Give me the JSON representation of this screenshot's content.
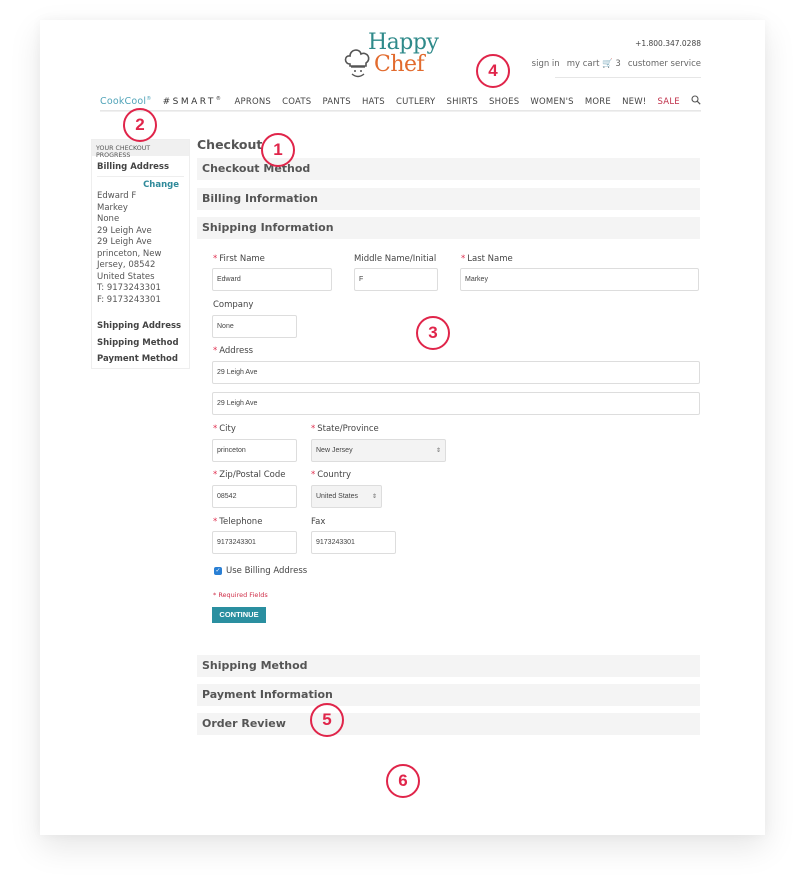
{
  "brand": {
    "line1": "Happy",
    "line2": "Chef",
    "accent": "#2f8a8a",
    "accent2": "#e26b2e"
  },
  "header": {
    "phone": "+1.800.347.0288",
    "utility_links": [
      {
        "label": "sign in"
      },
      {
        "label": "my cart 🛒 3"
      },
      {
        "label": "customer service"
      }
    ]
  },
  "nav": {
    "cookcool": "CookCool",
    "smart": "#SMART",
    "items": [
      "APRONS",
      "COATS",
      "PANTS",
      "HATS",
      "CUTLERY",
      "SHIRTS",
      "SHOES",
      "WOMEN'S",
      "MORE",
      "NEW!"
    ],
    "sale": "SALE",
    "sale_color": "#c0304a"
  },
  "sidebar": {
    "heading": "YOUR CHECKOUT PROGRESS",
    "billing_title": "Billing Address",
    "change_label": "Change",
    "address_lines": [
      "Edward F",
      "Markey",
      "None",
      "29 Leigh Ave",
      "29 Leigh Ave",
      "princeton, New",
      "Jersey, 08542",
      "United States",
      "T: 9173243301",
      "F: 9173243301"
    ],
    "steps": [
      "Shipping Address",
      "Shipping Method",
      "Payment Method"
    ]
  },
  "main": {
    "title": "Checkout",
    "sections_top": [
      "Checkout Method",
      "Billing Information",
      "Shipping Information"
    ],
    "sections_bottom": [
      "Shipping Method",
      "Payment Information",
      "Order Review"
    ],
    "form": {
      "first_name": {
        "label": "First Name",
        "required": "*",
        "value": "Edward"
      },
      "middle_name": {
        "label": "Middle Name/Initial",
        "value": "F"
      },
      "last_name": {
        "label": "Last Name",
        "required": "*",
        "value": "Markey"
      },
      "company": {
        "label": "Company",
        "value": "None"
      },
      "address": {
        "label": "Address",
        "required": "*",
        "line1": "29 Leigh Ave",
        "line2": "29 Leigh Ave"
      },
      "city": {
        "label": "City",
        "required": "*",
        "value": "princeton"
      },
      "state": {
        "label": "State/Province",
        "required": "*",
        "value": "New Jersey"
      },
      "zip": {
        "label": "Zip/Postal Code",
        "required": "*",
        "value": "08542"
      },
      "country": {
        "label": "Country",
        "required": "*",
        "value": "United States"
      },
      "telephone": {
        "label": "Telephone",
        "required": "*",
        "value": "9173243301"
      },
      "fax": {
        "label": "Fax",
        "value": "9173243301"
      },
      "use_billing": {
        "label": "Use Billing Address",
        "checked": true
      },
      "required_note": "* Required Fields",
      "continue_label": "CONTINUE"
    }
  },
  "markers": [
    "1",
    "2",
    "3",
    "4",
    "5",
    "6"
  ],
  "colors": {
    "button": "#2a8fa0",
    "link": "#2f8a9a",
    "required": "#e03050",
    "marker": "#e0254a"
  }
}
